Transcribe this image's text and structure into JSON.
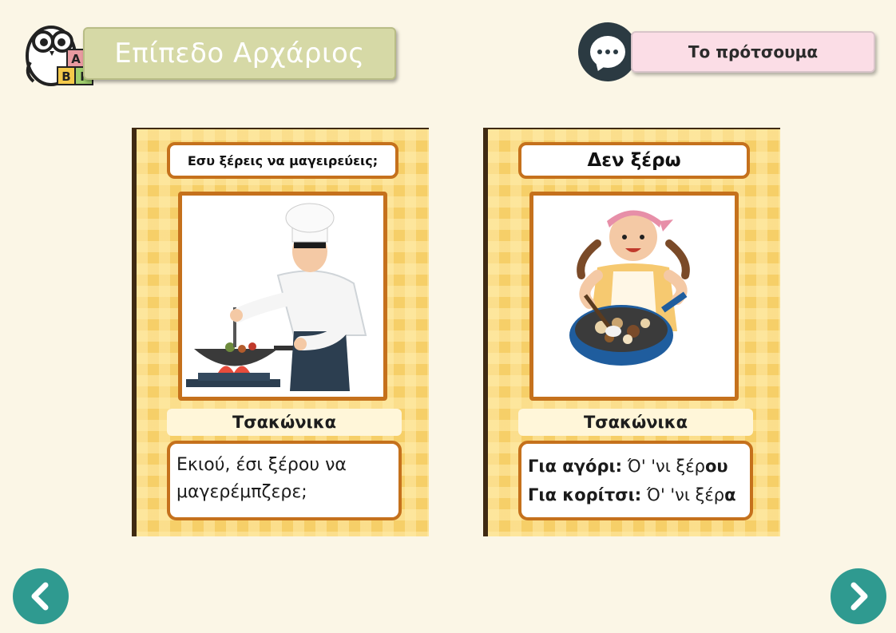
{
  "header": {
    "level_label": "Επίπεδο Αρχάριος",
    "logo_letters": [
      "Α",
      "Β",
      "Γ"
    ],
    "original_button": "Το πρότσουμα"
  },
  "cards": [
    {
      "title": "Εσυ ξέρεις να μαγειρεύεις;",
      "image_icon": "chef-cooking-illustration",
      "language_label": "Τσακώνικα",
      "answer": "Εκιού, έσι ξέρου να μαγερέμπζερε;"
    },
    {
      "title": "Δεν ξέρω",
      "image_icon": "girl-cooking-illustration",
      "language_label": "Τσακώνικα",
      "answer_lines": [
        {
          "label": "Για αγόρι:",
          "text": " Ό' 'νι ξέρ",
          "ending": "ου"
        },
        {
          "label": "Για κορίτσι:",
          "text": " Ό' 'νι ξέρ",
          "ending": "α"
        }
      ]
    }
  ],
  "nav": {
    "prev_icon": "chevron-left-icon",
    "next_icon": "chevron-right-icon"
  },
  "colors": {
    "background": "#fbf6e6",
    "card": "#f6cf68",
    "frame": "#c5711c",
    "nav": "#2f9a90"
  }
}
